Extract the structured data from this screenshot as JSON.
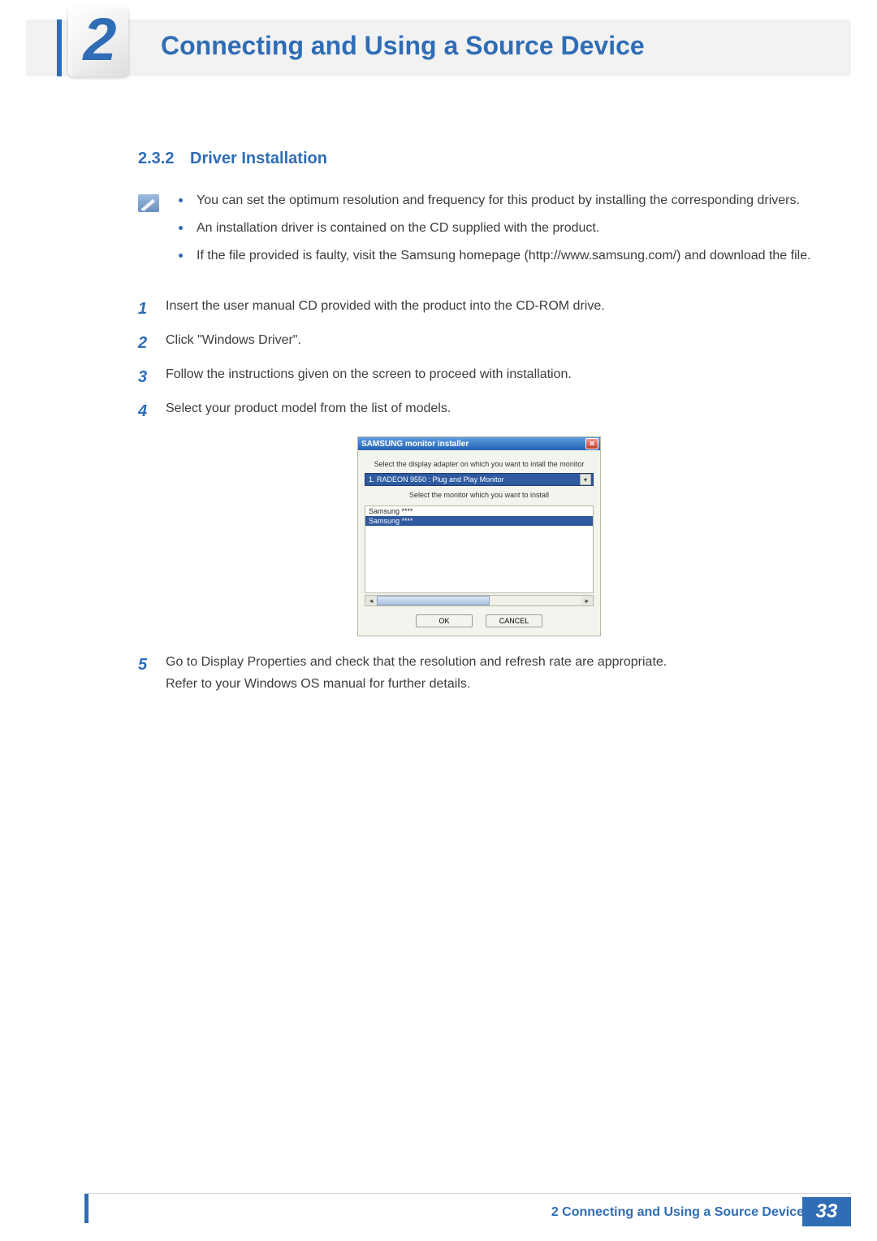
{
  "header": {
    "chapter_number": "2",
    "title": "Connecting and Using a Source Device"
  },
  "section": {
    "number": "2.3.2",
    "title": "Driver Installation"
  },
  "notes": [
    "You can set the optimum resolution and frequency for this product by installing the corresponding drivers.",
    "An installation driver is contained on the CD supplied with the product.",
    "If the file provided is faulty, visit the Samsung homepage (http://www.samsung.com/) and download the file."
  ],
  "steps": {
    "s1": {
      "n": "1",
      "text": "Insert the user manual CD provided with the product into the CD-ROM drive."
    },
    "s2": {
      "n": "2",
      "text": "Click \"Windows Driver\"."
    },
    "s3": {
      "n": "3",
      "text": "Follow the instructions given on the screen to proceed with installation."
    },
    "s4": {
      "n": "4",
      "text": "Select your product model from the list of models."
    },
    "s5": {
      "n": "5",
      "text_a": "Go to Display Properties and check that the resolution and refresh rate are appropriate.",
      "text_b": "Refer to your Windows OS manual for further details."
    }
  },
  "dialog": {
    "title": "SAMSUNG monitor installer",
    "close": "✕",
    "instr1": "Select the display adapter on which you want to intall the monitor",
    "adapter_selected": "1. RADEON 9550 : Plug and Play Monitor",
    "instr2": "Select the monitor which you want to install",
    "list": {
      "item0": "Samsung ****",
      "item1": "Samsung ****"
    },
    "ok": "OK",
    "cancel": "CANCEL"
  },
  "footer": {
    "text": "2 Connecting and Using a Source Device",
    "page": "33"
  }
}
